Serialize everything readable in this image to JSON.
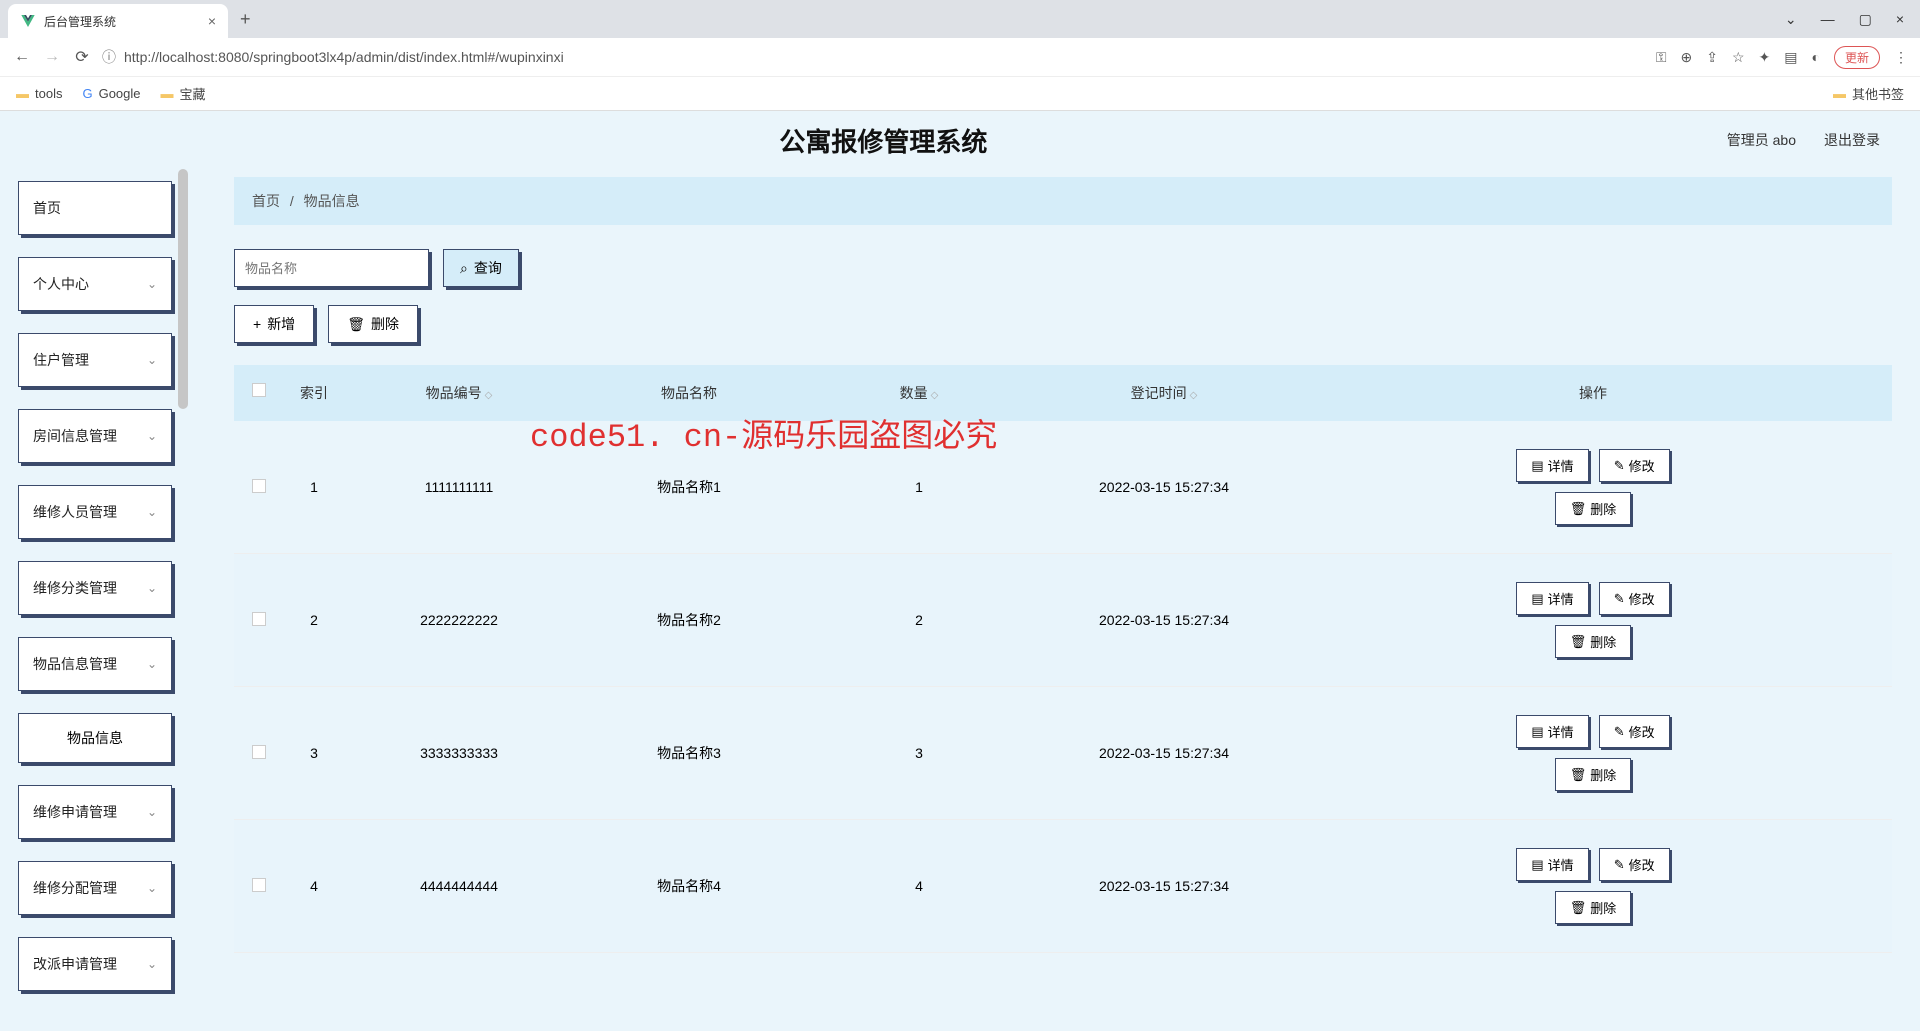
{
  "browser": {
    "tab_title": "后台管理系统",
    "url": "http://localhost:8080/springboot3lx4p/admin/dist/index.html#/wupinxinxi",
    "update_label": "更新",
    "bookmarks": {
      "tools": "tools",
      "google": "Google",
      "treasure": "宝藏",
      "other": "其他书签"
    }
  },
  "header": {
    "title": "公寓报修管理系统",
    "user": "管理员 abo",
    "logout": "退出登录"
  },
  "sidebar": {
    "items": [
      {
        "label": "首页",
        "expandable": false
      },
      {
        "label": "个人中心",
        "expandable": true
      },
      {
        "label": "住户管理",
        "expandable": true
      },
      {
        "label": "房间信息管理",
        "expandable": true
      },
      {
        "label": "维修人员管理",
        "expandable": true
      },
      {
        "label": "维修分类管理",
        "expandable": true
      },
      {
        "label": "物品信息管理",
        "expandable": true
      },
      {
        "label": "维修申请管理",
        "expandable": true
      },
      {
        "label": "维修分配管理",
        "expandable": true
      },
      {
        "label": "改派申请管理",
        "expandable": true
      }
    ],
    "sub_item": "物品信息"
  },
  "breadcrumb": {
    "home": "首页",
    "sep": "/",
    "current": "物品信息"
  },
  "search": {
    "placeholder": "物品名称",
    "btn": "查询"
  },
  "actions": {
    "add": "新增",
    "delete": "删除"
  },
  "table": {
    "headers": {
      "index": "索引",
      "code": "物品编号",
      "name": "物品名称",
      "qty": "数量",
      "time": "登记时间",
      "ops": "操作"
    },
    "ops_labels": {
      "detail": "详情",
      "edit": "修改",
      "delete": "删除"
    },
    "rows": [
      {
        "index": "1",
        "code": "1111111111",
        "name": "物品名称1",
        "qty": "1",
        "time": "2022-03-15 15:27:34"
      },
      {
        "index": "2",
        "code": "2222222222",
        "name": "物品名称2",
        "qty": "2",
        "time": "2022-03-15 15:27:34"
      },
      {
        "index": "3",
        "code": "3333333333",
        "name": "物品名称3",
        "qty": "3",
        "time": "2022-03-15 15:27:34"
      },
      {
        "index": "4",
        "code": "4444444444",
        "name": "物品名称4",
        "qty": "4",
        "time": "2022-03-15 15:27:34"
      }
    ]
  },
  "watermark": "code51. cn-源码乐园盗图必究"
}
